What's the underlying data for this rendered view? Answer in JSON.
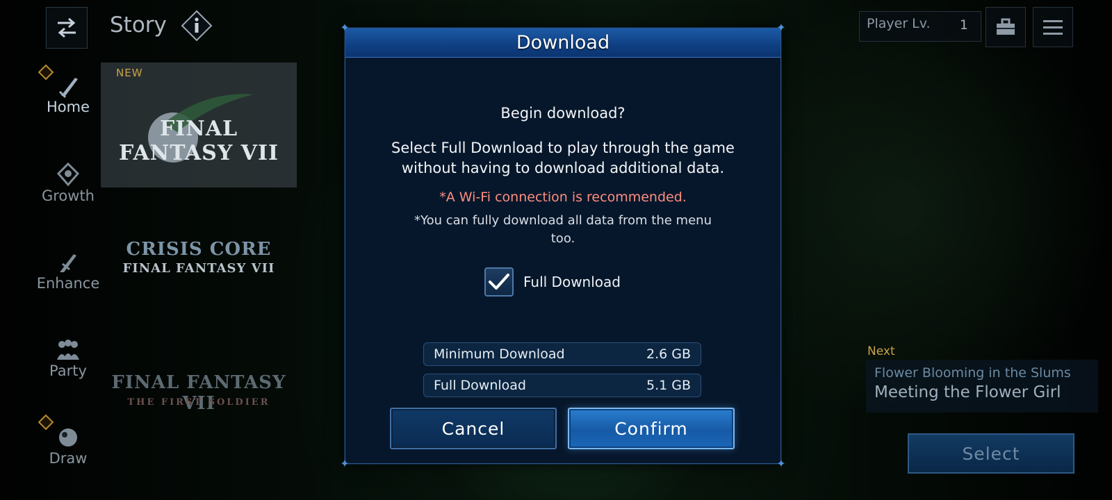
{
  "header": {
    "title": "Story",
    "info_icon": "info-icon",
    "back_icon": "swap-arrows-icon",
    "player_level_label": "Player Lv.",
    "player_level_value": "1",
    "toolbox_icon": "toolbox-icon",
    "menu_icon": "hamburger-menu-icon"
  },
  "nav": {
    "items": [
      {
        "label": "Home",
        "icon": "sword-icon",
        "active": true,
        "badge": true
      },
      {
        "label": "Growth",
        "icon": "crystal-icon",
        "active": false,
        "badge": false
      },
      {
        "label": "Enhance",
        "icon": "blade-icon",
        "active": false,
        "badge": false
      },
      {
        "label": "Party",
        "icon": "party-icon",
        "active": false,
        "badge": false
      },
      {
        "label": "Draw",
        "icon": "orb-icon",
        "active": false,
        "badge": true
      }
    ]
  },
  "games": [
    {
      "tag": "NEW",
      "logo_line1": "FINAL FANTASY VII",
      "selected": true
    },
    {
      "logo_line1": "CRISIS CORE",
      "logo_line2": "FINAL FANTASY VII",
      "selected": false
    },
    {
      "logo_line1": "FINAL FANTASY VII",
      "logo_line2": "THE FIRST SOLDIER",
      "selected": false
    }
  ],
  "next": {
    "label": "Next",
    "chapter": "Flower Blooming in the Slums",
    "episode": "Meeting the Flower Girl",
    "select_label": "Select"
  },
  "dialog": {
    "title": "Download",
    "question": "Begin download?",
    "description": "Select Full Download to play through the game without having to download additional data.",
    "warning": "*A Wi-Fi connection is recommended.",
    "note": "*You can fully download all data from the menu too.",
    "checkbox_label": "Full Download",
    "checkbox_checked": true,
    "sizes": [
      {
        "label": "Minimum Download",
        "value": "2.6 GB"
      },
      {
        "label": "Full Download",
        "value": "5.1 GB"
      }
    ],
    "cancel_label": "Cancel",
    "confirm_label": "Confirm"
  },
  "colors": {
    "accent_blue": "#1c5aa6",
    "warning_red": "#ff8e80",
    "gold": "#c9a44a"
  }
}
